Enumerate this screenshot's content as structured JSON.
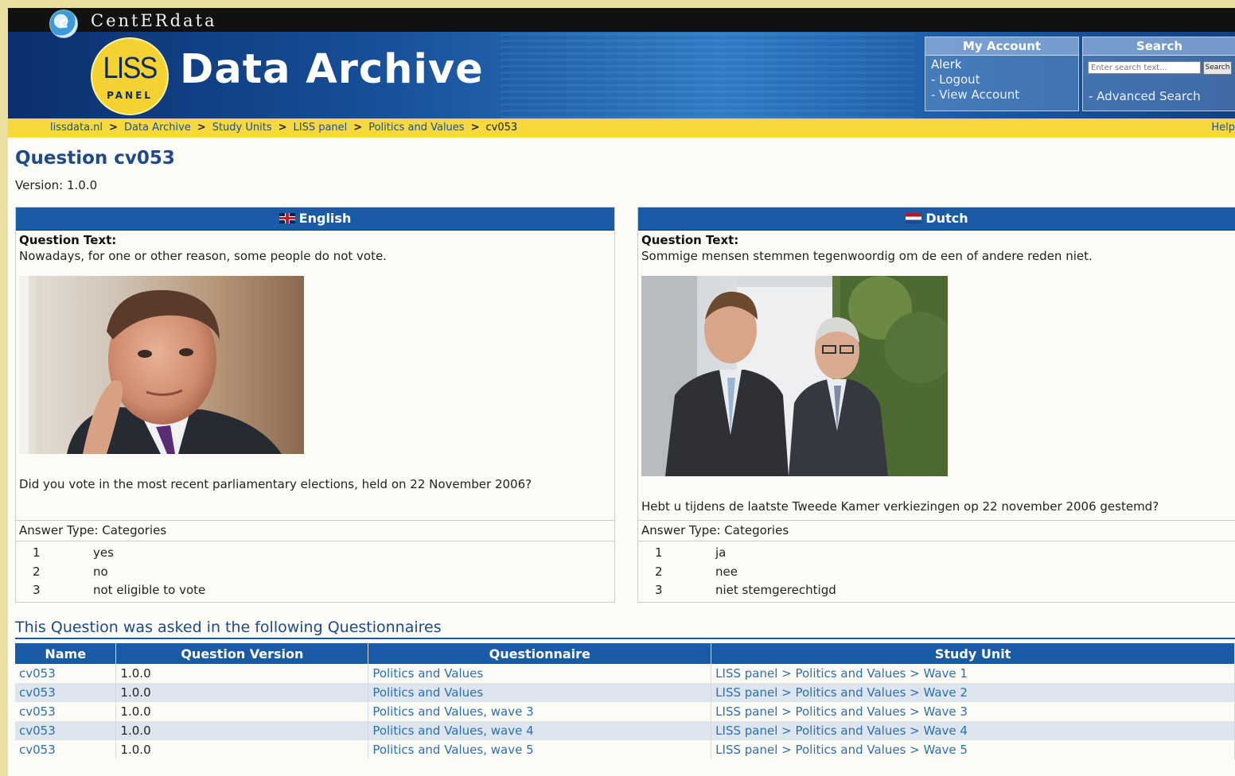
{
  "header": {
    "org_name": "CentERdata",
    "org_logo_letter": "C",
    "logo_main": "LISS",
    "logo_sub": "PANEL",
    "site_title": "Data Archive"
  },
  "account": {
    "title": "My Account",
    "user": "Alerk",
    "logout": "- Logout",
    "view_account": "- View Account"
  },
  "search": {
    "title": "Search",
    "placeholder": "Enter search text...",
    "button": "Search",
    "advanced": "- Advanced Search"
  },
  "breadcrumb": {
    "items": [
      "lissdata.nl",
      "Data Archive",
      "Study Units",
      "LISS panel",
      "Politics and Values"
    ],
    "current": "cv053",
    "separator": ">",
    "help": "Help"
  },
  "question": {
    "title": "Question cv053",
    "version": "Version: 1.0.0"
  },
  "english": {
    "lang_label": "English",
    "qt_label": "Question Text:",
    "intro": "Nowadays, for one or other reason, some people do not vote.",
    "question": "Did you vote in the most recent parliamentary elections, held on 22 November 2006?",
    "answer_type": "Answer Type: Categories",
    "answers": [
      {
        "code": "1",
        "label": "yes"
      },
      {
        "code": "2",
        "label": "no"
      },
      {
        "code": "3",
        "label": "not eligible to vote"
      }
    ]
  },
  "dutch": {
    "lang_label": "Dutch",
    "qt_label": "Question Text:",
    "intro": "Sommige mensen stemmen tegenwoordig om de een of andere reden niet.",
    "question": "Hebt u tijdens de laatste Tweede Kamer verkiezingen op 22 november 2006 gestemd?",
    "answer_type": "Answer Type: Categories",
    "answers": [
      {
        "code": "1",
        "label": "ja"
      },
      {
        "code": "2",
        "label": "nee"
      },
      {
        "code": "3",
        "label": "niet stemgerechtigd"
      }
    ]
  },
  "questionnaires": {
    "title": "This Question was asked in the following Questionnaires",
    "columns": [
      "Name",
      "Question Version",
      "Questionnaire",
      "Study Unit"
    ],
    "rows": [
      {
        "name": "cv053",
        "version": "1.0.0",
        "questionnaire": "Politics and Values",
        "study_unit": "LISS panel > Politics and Values > Wave 1"
      },
      {
        "name": "cv053",
        "version": "1.0.0",
        "questionnaire": "Politics and Values",
        "study_unit": "LISS panel > Politics and Values > Wave 2"
      },
      {
        "name": "cv053",
        "version": "1.0.0",
        "questionnaire": "Politics and Values, wave 3",
        "study_unit": "LISS panel > Politics and Values > Wave 3"
      },
      {
        "name": "cv053",
        "version": "1.0.0",
        "questionnaire": "Politics and Values, wave 4",
        "study_unit": "LISS panel > Politics and Values > Wave 4"
      },
      {
        "name": "cv053",
        "version": "1.0.0",
        "questionnaire": "Politics and Values, wave 5",
        "study_unit": "LISS panel > Politics and Values > Wave 5"
      }
    ]
  },
  "colors": {
    "header_blue": "#1a5ba6",
    "breadcrumb_yellow": "#f5d93e",
    "link_blue": "#2a6fb8",
    "title_blue": "#1c4a8a"
  }
}
